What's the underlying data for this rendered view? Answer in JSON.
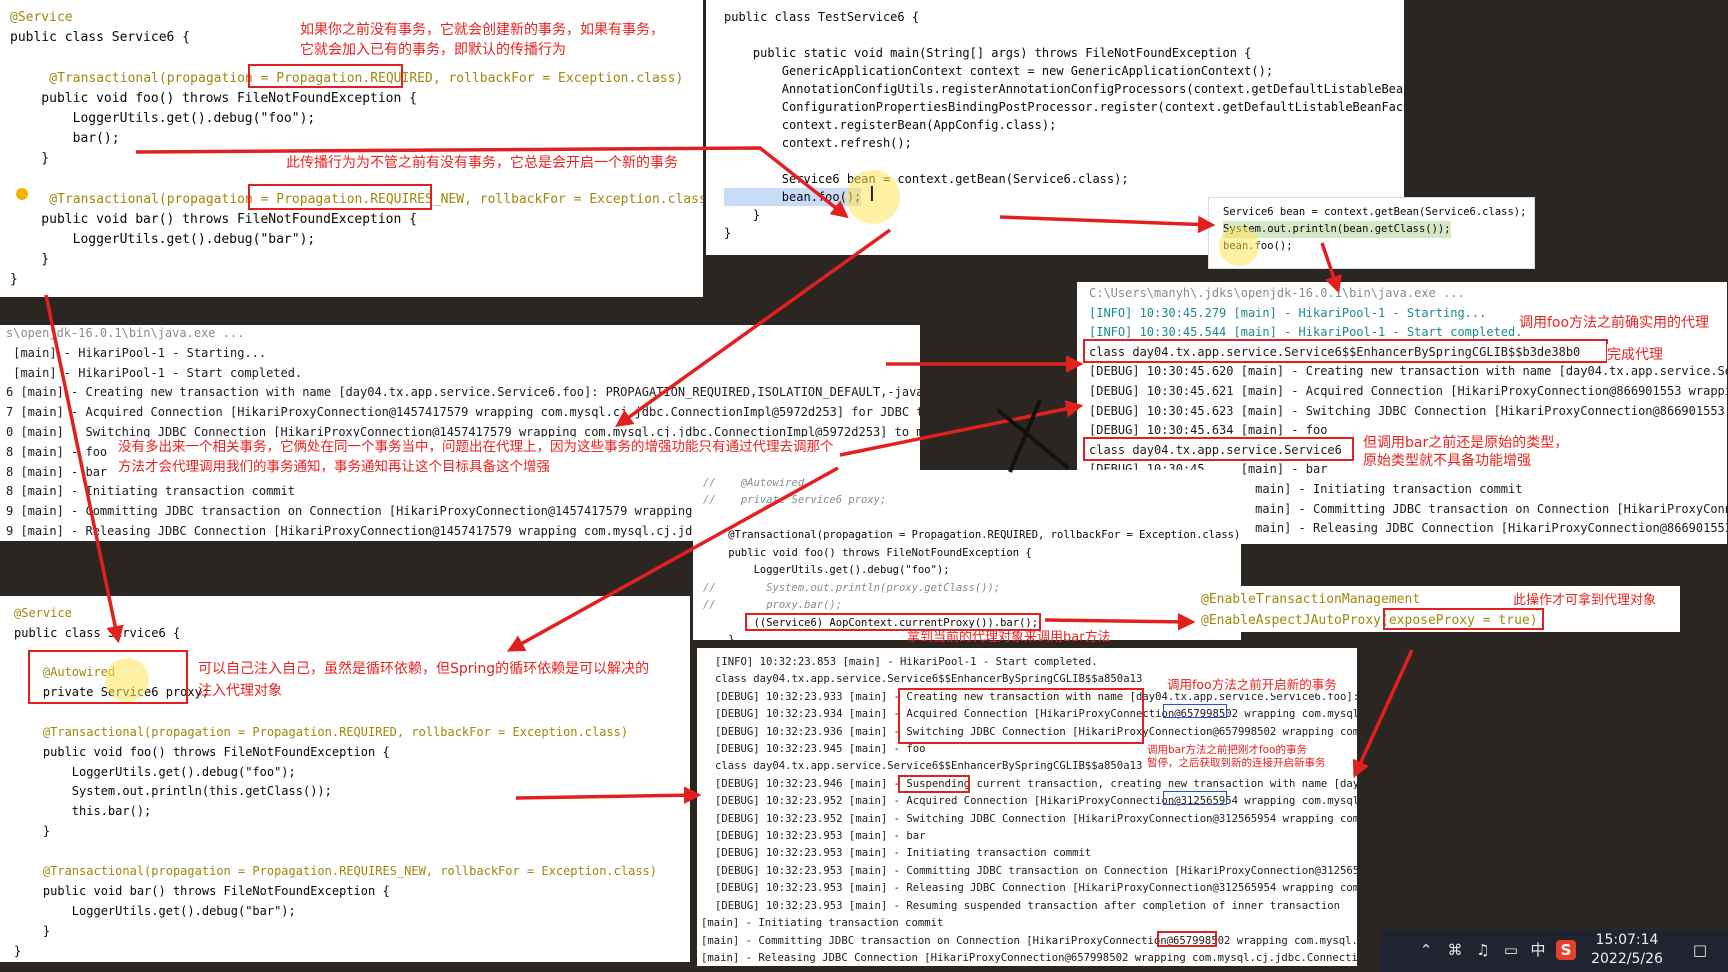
{
  "p1": {
    "lines": [
      "@Service",
      "public class Service6 {",
      "    @Transactional(propagation = Propagation.REQUIRED, rollbackFor = Exception.class)",
      "    public void foo() throws FileNotFoundException {",
      "        LoggerUtils.get().debug(\"foo\");",
      "        bar();",
      "    }",
      "    @Transactional(propagation = Propagation.REQUIRES_NEW, rollbackFor = Exception.class)",
      "    public void bar() throws FileNotFoundException {",
      "        LoggerUtils.get().debug(\"bar\");",
      "    }",
      "}"
    ],
    "ann_required": "如果你之前没有事务，它就会创建新的事务，如果有事务，\n它就会加入已有的事务，即默认的传播行为",
    "ann_requires_new": "此传播行为为不管之前有没有事务，它总是会开启一个新的事务"
  },
  "p2": {
    "lines": [
      "public class TestService6 {",
      "    public static void main(String[] args) throws FileNotFoundException {",
      "        GenericApplicationContext context = new GenericApplicationContext();",
      "        AnnotationConfigUtils.registerAnnotationConfigProcessors(context.getDefaultListableBeanFactory()",
      "        ConfigurationPropertiesBindingPostProcessor.register(context.getDefaultListableBeanFactory());",
      "        context.registerBean(AppConfig.class);",
      "        context.refresh();",
      "        Service6 bean = context.getBean(Service6.class);",
      "        bean.foo();",
      "    }",
      "}"
    ]
  },
  "popup1": {
    "lines": [
      "Service6 bean = context.getBean(Service6.class);",
      "System.out.println(bean.getClass());",
      "bean.foo();"
    ]
  },
  "p3": {
    "lines": [
      "C:\\Users\\manyh\\.jdks\\openjdk-16.0.1\\bin\\java.exe ...",
      "[INFO] 10:30:45.279 [main] - HikariPool-1 - Starting...",
      "[INFO] 10:30:45.544 [main] - HikariPool-1 - Start completed.",
      "class day04.tx.app.service.Service6$$EnhancerBySpringCGLIB$$b3de38b0",
      "[DEBUG] 10:30:45.620 [main] - Creating new transaction with name [day04.tx.app.service.Se",
      "[DEBUG] 10:30:45.621 [main] - Acquired Connection [HikariProxyConnection@866901553 wrappi",
      "[DEBUG] 10:30:45.623 [main] - Switching JDBC Connection [HikariProxyConnection@866901553",
      "[DEBUG] 10:30:45.634 [main] - foo",
      "class day04.tx.app.service.Service6",
      "[DEBUG] 10:30:45.    [main] - bar",
      "                       main] - Initiating transaction commit",
      "                       main] - Committing JDBC transaction on Connection [HikariProxyConne",
      "                       main] - Releasing JDBC Connection [HikariProxyConnection@866901553"
    ],
    "ann_proxy": "调用foo方法之前确实用的代理",
    "ann_done": "完成代理",
    "ann_original": "但调用bar之前还是原始的类型，\n原始类型就不具备功能增强"
  },
  "p4": {
    "lines": [
      "s\\openjdk-16.0.1\\bin\\java.exe ...",
      " [main] - HikariPool-1 - Starting...",
      " [main] - HikariPool-1 - Start completed.",
      "6 [main] - Creating new transaction with name [day04.tx.app.service.Service6.foo]: PROPAGATION_REQUIRED,ISOLATION_DEFAULT,-java",
      "7 [main] - Acquired Connection [HikariProxyConnection@1457417579 wrapping com.mysql.cj.jdbc.ConnectionImpl@5972d253] for JDBC t",
      "0 [main] - Switching JDBC Connection [HikariProxyConnection@1457417579 wrapping com.mysql.cj.jdbc.ConnectionImpl@5972d253] to m",
      "8 [main] - foo",
      "8 [main] - bar",
      "8 [main] - Initiating transaction commit",
      "9 [main] - Committing JDBC transaction on Connection [HikariProxyConnection@1457417579 wrapping",
      "9 [main] - Releasing JDBC Connection [HikariProxyConnection@1457417579 wrapping com.mysql.cj.jd"
    ],
    "ann": "没有多出来一个相关事务，它俩处在同一个事务当中，问题出在代理上，因为这些事务的增强功能只有通过代理去调那个\n方法才会代理调用我们的事务通知，事务通知再让这个目标具备这个增强"
  },
  "p5": {
    "lines": [
      "@Service",
      "public class Service6 {",
      "    @Autowired",
      "    private Service6 proxy;",
      "    @Transactional(propagation = Propagation.REQUIRED, rollbackFor = Exception.class)",
      "    public void foo() throws FileNotFoundException {",
      "        LoggerUtils.get().debug(\"foo\");",
      "        System.out.println(this.getClass());",
      "        this.bar();",
      "    }",
      "    @Transactional(propagation = Propagation.REQUIRES_NEW, rollbackFor = Exception.class)",
      "    public void bar() throws FileNotFoundException {",
      "        LoggerUtils.get().debug(\"bar\");",
      "    }",
      "}"
    ],
    "ann": "可以自己注入自己，虽然是循环依赖，但Spring的循环依赖是可以解决的\n注入代理对象"
  },
  "p6": {
    "lines": [
      "//    @Autowired",
      "//    private Service6 proxy;",
      "    @Transactional(propagation = Propagation.REQUIRED, rollbackFor = Exception.class)",
      "    public void foo() throws FileNotFoundException {",
      "        LoggerUtils.get().debug(\"foo\");",
      "//        System.out.println(proxy.getClass());",
      "//        proxy.bar();",
      "        ((Service6) AopContext.currentProxy()).bar();",
      "    }"
    ],
    "ann": "拿到当前的代理对象来调用bar方法"
  },
  "p7": {
    "lines": [
      "@EnableTransactionManagement",
      "@EnableAspectJAutoProxy(exposeProxy = true)"
    ],
    "ann": "此操作才可拿到代理对象"
  },
  "p8": {
    "lines": [
      "[INFO] 10:32:23.853 [main] - HikariPool-1 - Start completed.",
      "class day04.tx.app.service.Service6$$EnhancerBySpringCGLIB$$a850a13",
      "[DEBUG] 10:32:23.933 [main] - Creating new transaction with name [day04.tx.app.service.Service6.foo]:",
      "[DEBUG] 10:32:23.934 [main] - Acquired Connection [HikariProxyConnection@657998502 wrapping com.mysql.",
      "[DEBUG] 10:32:23.936 [main] - Switching JDBC Connection [HikariProxyConnection@657998502 wrapping com.",
      "[DEBUG] 10:32:23.945 [main] - foo",
      "class day04.tx.app.service.Service6$$EnhancerBySpringCGLIB$$a850a13",
      "[DEBUG] 10:32:23.946 [main] - Suspending current transaction, creating new transaction with name [day0",
      "[DEBUG] 10:32:23.952 [main] - Acquired Connection [HikariProxyConnection@312565954 wrapping com.mysql.",
      "[DEBUG] 10:32:23.952 [main] - Switching JDBC Connection [HikariProxyConnection@312565954 wrapping com.",
      "[DEBUG] 10:32:23.953 [main] - bar",
      "[DEBUG] 10:32:23.953 [main] - Initiating transaction commit",
      "[DEBUG] 10:32:23.953 [main] - Committing JDBC transaction on Connection [HikariProxyConnection@3125659",
      "[DEBUG] 10:32:23.953 [main] - Releasing JDBC Connection [HikariProxyConnection@312565954 wrapping com.",
      "[DEBUG] 10:32:23.953 [main] - Resuming suspended transaction after completion of inner transaction",
      "[main] - Initiating transaction commit",
      "[main] - Committing JDBC transaction on Connection [HikariProxyConnection@657998502 wrapping com.mysql.",
      "[main] - Releasing JDBC Connection [HikariProxyConnection@657998502 wrapping com.mysql.cj.jdbc.Connecti"
    ],
    "ann_foo": "调用foo方法之前开启新的事务",
    "ann_bar": "调用bar方法之前把刚才foo的事务\n暂停，之后获取到新的连接开启新事务"
  },
  "taskbar": {
    "time": "15:07:14",
    "date": "2022/5/26",
    "ime": "中"
  }
}
